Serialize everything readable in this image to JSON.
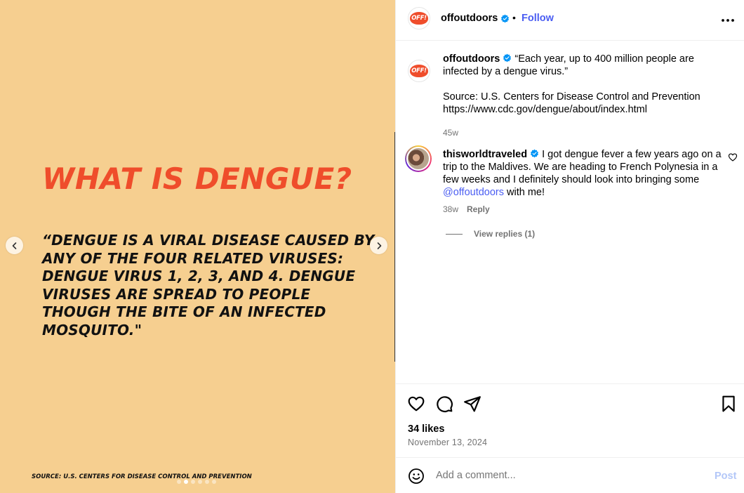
{
  "media": {
    "headline": "WHAT IS DENGUE?",
    "quote": "“DENGUE IS A VIRAL DISEASE CAUSED BY ANY OF THE FOUR RELATED VIRUSES: DENGUE VIRUS 1, 2, 3, AND 4. DENGUE VIRUSES ARE SPREAD TO PEOPLE THOUGH THE BITE OF AN INFECTED MOSQUITO.\"",
    "source": "SOURCE: U.S. CENTERS FOR DISEASE CONTROL AND PREVENTION",
    "background_color": "#f6cf90",
    "headline_color": "#ef4d2b",
    "slide_count": 6,
    "active_slide": 2
  },
  "header": {
    "username": "offoutdoors",
    "separator": "•",
    "follow_label": "Follow",
    "more_icon": "more-horizontal-icon",
    "avatar_text": "OFF!"
  },
  "caption": {
    "username": "offoutdoors",
    "text_line1": " “Each year, up to 400 million people are infected by a dengue virus.”",
    "source_line": "Source: U.S. Centers for Disease Control and Prevention",
    "url": "https://www.cdc.gov/dengue/about/index.html",
    "age": "45w"
  },
  "comment": {
    "username": "thisworldtraveled",
    "text": " I got dengue fever a few years ago on a trip to the Maldives. We are heading to French Polynesia in a few weeks and I definitely should look into bringing some ",
    "mention": "@offoutdoors",
    "text_end": " with me!",
    "age": "38w",
    "reply_label": "Reply",
    "view_replies": "View replies (1)"
  },
  "actions": {
    "likes": "34 likes",
    "date": "November 13, 2024"
  },
  "add_comment": {
    "placeholder": "Add a comment...",
    "post_label": "Post"
  },
  "colors": {
    "link": "#4a5df2",
    "muted": "#737373",
    "post_disabled": "#b3c7f8"
  }
}
